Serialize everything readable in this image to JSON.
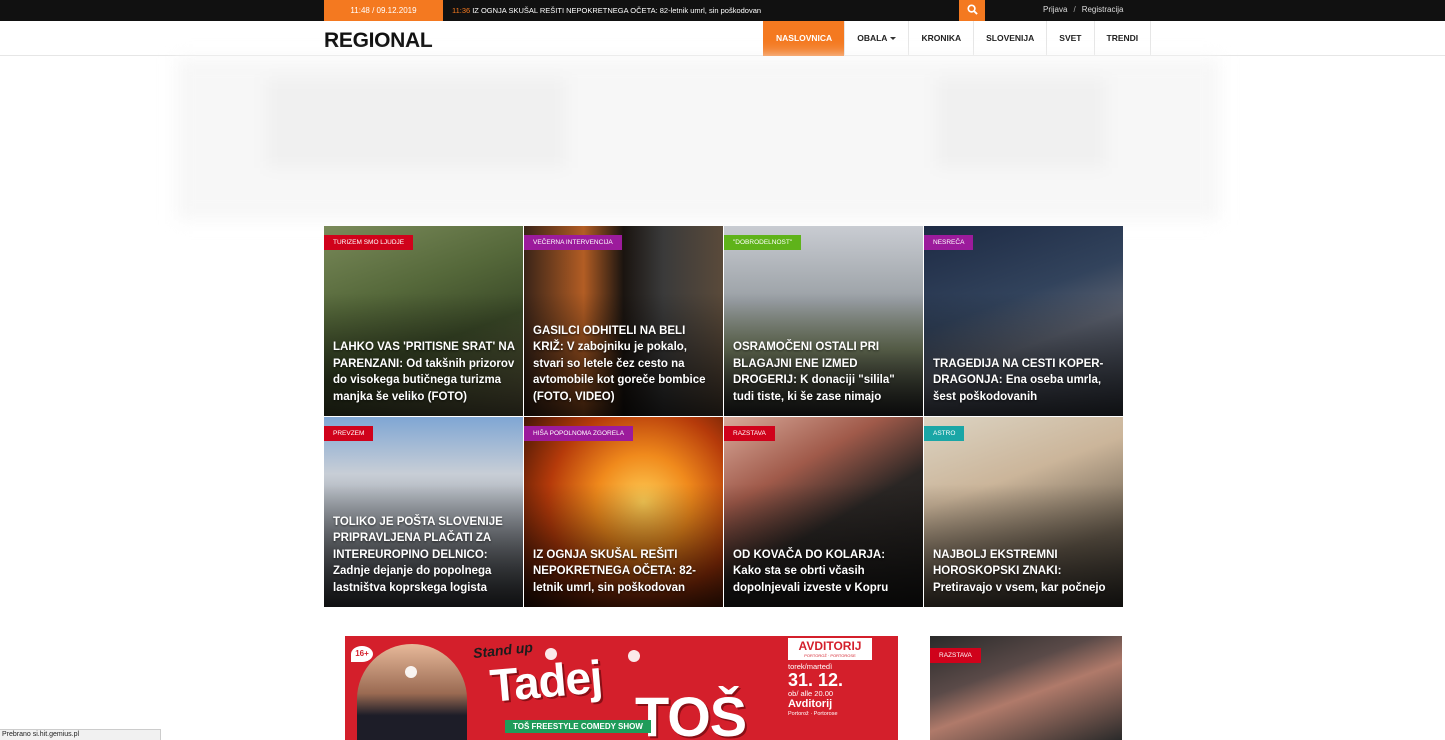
{
  "topbar": {
    "datetime": "11:48 / 09.12.2019",
    "ticker_time": "11:36",
    "ticker_text": "IZ OGNJA SKUŠAL REŠITI NEPOKRETNEGA OČETA: 82-letnik umrl, sin poškodovan",
    "login": "Prijava",
    "separator": "/",
    "register": "Registracija",
    "search_icon": "search-icon",
    "accent": "#f47920"
  },
  "header": {
    "logo": "REGIONAL",
    "nav": [
      {
        "label": "NASLOVNICA",
        "active": true
      },
      {
        "label": "OBALA",
        "dropdown": true
      },
      {
        "label": "KRONIKA"
      },
      {
        "label": "SLOVENIJA"
      },
      {
        "label": "SVET"
      },
      {
        "label": "TRENDI"
      }
    ]
  },
  "articles": [
    {
      "category": "TURIZEM SMO LJUDJE",
      "color": "#d0021b",
      "title": "LAHKO VAS 'PRITISNE SRAT' NA PARENZANI: Od takšnih prizorov do visokega butičnega turizma manjka še veliko (FOTO)"
    },
    {
      "category": "VEČERNA INTERVENCIJA",
      "color": "#9c1b9c",
      "title": "GASILCI ODHITELI NA BELI KRIŽ: V zabojniku je pokalo, stvari so letele čez cesto na avtomobile kot goreče bombice (FOTO, VIDEO)"
    },
    {
      "category": "\"DOBRODELNOST\"",
      "color": "#5fb31a",
      "title": "OSRAMOČENI OSTALI PRI BLAGAJNI ENE IZMED DROGERIJ: K donaciji \"silila\" tudi tiste, ki še zase nimajo"
    },
    {
      "category": "NESREČA",
      "color": "#9c1b9c",
      "title": "TRAGEDIJA NA CESTI KOPER-DRAGONJA: Ena oseba umrla, šest poškodovanih"
    },
    {
      "category": "PREVZEM",
      "color": "#d0021b",
      "title": "TOLIKO JE POŠTA SLOVENIJE PRIPRAVLJENA PLAČATI ZA INTEREUROPINO DELNICO: Zadnje dejanje do popolnega lastništva koprskega logista"
    },
    {
      "category": "HIŠA POPOLNOMA ZGORELA",
      "color": "#9c1b9c",
      "title": "IZ OGNJA SKUŠAL REŠITI NEPOKRETNEGA OČETA: 82-letnik umrl, sin poškodovan"
    },
    {
      "category": "RAZSTAVA",
      "color": "#d0021b",
      "title": "OD KOVAČA DO KOLARJA: Kako sta se obrti včasih dopolnjevali izveste v Kopru"
    },
    {
      "category": "ASTRO",
      "color": "#1aa6a6",
      "title": "NAJBOLJ EKSTREMNI HOROSKOPSKI ZNAKI: Pretiravajo v vsem, kar počnejo"
    }
  ],
  "banner": {
    "age": "16+",
    "standup": "Stand up",
    "name": "Tadej",
    "comedy": "comedy",
    "surname": "TOŠ",
    "show": "TOŠ FREESTYLE COMEDY SHOW",
    "venue": "AVDITORIJ",
    "venue_sub": "PORTOROŽ · PORTOROSE",
    "day": "torek/martedì",
    "date": "31. 12.",
    "time": "ob/ alle 20.00",
    "place": "Avditorij",
    "city": "Portorož · Portorose"
  },
  "side_article": {
    "category": "RAZSTAVA",
    "color": "#d0021b"
  },
  "statusbar": "Prebrano si.hit.gemius.pl"
}
